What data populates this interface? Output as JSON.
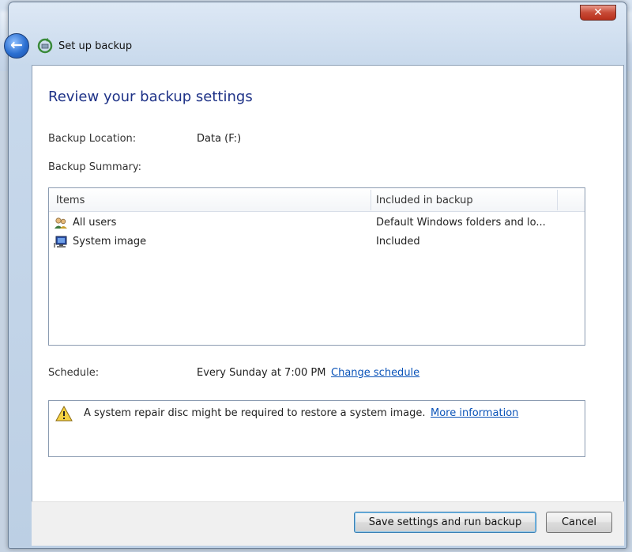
{
  "window": {
    "title": "Set up backup",
    "close_label": "✕"
  },
  "page": {
    "heading": "Review your backup settings"
  },
  "backup_location": {
    "label": "Backup Location:",
    "value": "Data (F:)"
  },
  "backup_summary": {
    "label": "Backup Summary:"
  },
  "table": {
    "columns": [
      "Items",
      "Included in backup"
    ],
    "rows": [
      {
        "name": "All users",
        "included": "Default Windows folders and lo...",
        "icon": "users-icon"
      },
      {
        "name": "System image",
        "included": "Included",
        "icon": "computer-icon"
      }
    ]
  },
  "schedule": {
    "label": "Schedule:",
    "value": "Every Sunday at 7:00 PM",
    "link": "Change schedule"
  },
  "warning": {
    "text": "A system repair disc might be required to restore a system image.",
    "link": "More information",
    "icon": "warning-icon"
  },
  "buttons": {
    "save": "Save settings and run backup",
    "cancel": "Cancel"
  },
  "colors": {
    "heading": "#1e3287",
    "link": "#0a53b8",
    "close": "#c74a36"
  }
}
